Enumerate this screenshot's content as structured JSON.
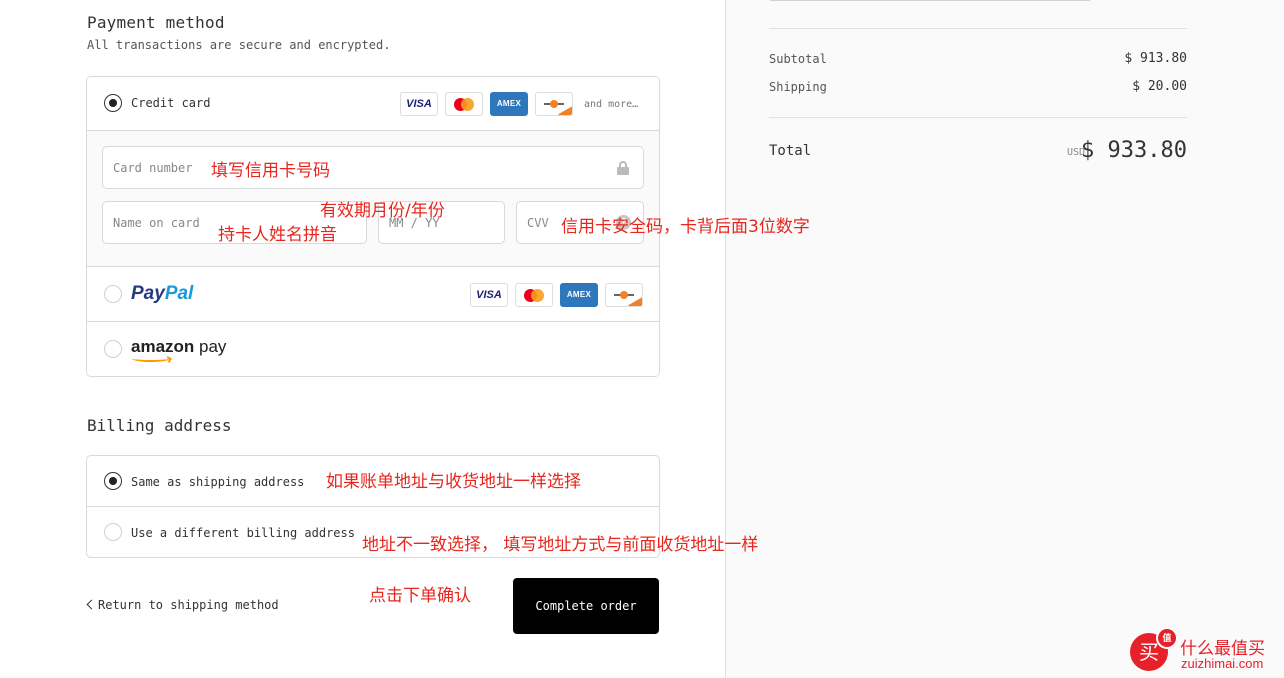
{
  "payment": {
    "title": "Payment method",
    "subtitle": "All transactions are secure and encrypted.",
    "credit_card": {
      "label": "Credit card",
      "cards": [
        "VISA",
        "Mastercard",
        "AMEX",
        "Discover"
      ],
      "amex_text": "AMEX",
      "visa_text": "VISA",
      "more_text": "and more…",
      "selected": true
    },
    "form": {
      "card_number_placeholder": "Card number",
      "name_placeholder": "Name on card",
      "expiry_placeholder": "MM / YY",
      "cvv_placeholder": "CVV"
    },
    "paypal": {
      "text_a": "Pay",
      "text_b": "Pal",
      "selected": false
    },
    "amazon": {
      "text_a": "amazon",
      "text_b": " pay",
      "selected": false
    }
  },
  "billing": {
    "title": "Billing address",
    "options": [
      {
        "label": "Same as shipping address",
        "selected": true
      },
      {
        "label": "Use a different billing address",
        "selected": false
      }
    ]
  },
  "actions": {
    "return_label": "Return to shipping method",
    "complete_label": "Complete order"
  },
  "summary": {
    "subtotal_label": "Subtotal",
    "subtotal_value": "$ 913.80",
    "shipping_label": "Shipping",
    "shipping_value": "$ 20.00",
    "total_label": "Total",
    "currency": "USD",
    "total_value": "$ 933.80"
  },
  "annotations": {
    "card_number": "填写信用卡号码",
    "expiry": "有效期月份/年份",
    "name": "持卡人姓名拼音",
    "cvv": "信用卡安全码，卡背后面3位数字",
    "same_address": "如果账单地址与收货地址一样选择",
    "different_address": "地址不一致选择， 填写地址方式与前面收货地址一样",
    "place_order": "点击下单确认"
  },
  "watermark": {
    "icon_char": "买",
    "badge": "值",
    "name": "什么最值买",
    "url": "zuizhimai.com"
  },
  "colors": {
    "annotation": "#e8261d",
    "button": "#000000",
    "amex": "#2e77bc",
    "paypal_dark": "#253b80",
    "paypal_light": "#179bd7",
    "amazon_orange": "#ff9900",
    "watermark": "#e62129"
  }
}
